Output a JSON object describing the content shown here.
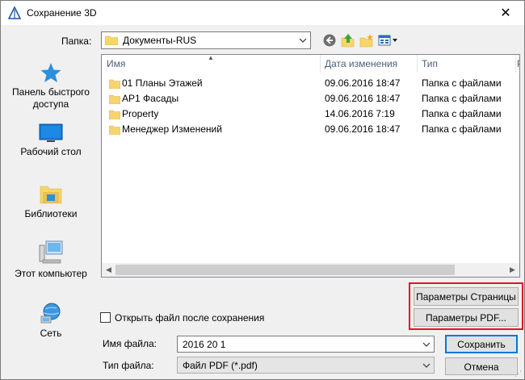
{
  "window": {
    "title": "Сохранение 3D",
    "close_symbol": "✕"
  },
  "folder": {
    "label": "Папка:",
    "value": "Документы-RUS"
  },
  "toolbar": {
    "icons": [
      "back-icon",
      "up-folder-icon",
      "new-folder-icon",
      "view-menu-icon"
    ]
  },
  "places": [
    {
      "label": "Панель быстрого доступа",
      "icon": "star-icon"
    },
    {
      "label": "Рабочий стол",
      "icon": "desktop-icon"
    },
    {
      "label": "Библиотеки",
      "icon": "libraries-icon"
    },
    {
      "label": "Этот компьютер",
      "icon": "computer-icon"
    },
    {
      "label": "Сеть",
      "icon": "network-icon"
    }
  ],
  "filelist": {
    "columns": [
      "Имя",
      "Дата изменения",
      "Тип",
      "Р"
    ],
    "rows": [
      {
        "name": "01 Планы Этажей",
        "date": "09.06.2016 18:47",
        "type": "Папка с файлами"
      },
      {
        "name": "АР1 Фасады",
        "date": "09.06.2016 18:47",
        "type": "Папка с файлами"
      },
      {
        "name": "Property",
        "date": "14.06.2016 7:19",
        "type": "Папка с файлами"
      },
      {
        "name": "Менеджер Изменений",
        "date": "09.06.2016 18:47",
        "type": "Папка с файлами"
      }
    ]
  },
  "buttons": {
    "page_params": "Параметры Страницы",
    "pdf_params": "Параметры PDF...",
    "save": "Сохранить",
    "cancel": "Отмена"
  },
  "open_after_save": {
    "label": "Открыть файл после сохранения",
    "checked": false
  },
  "filename": {
    "label": "Имя файла:",
    "value": "2016 20 1"
  },
  "filetype": {
    "label": "Тип файла:",
    "value": "Файл PDF (*.pdf)"
  },
  "colors": {
    "highlight": "#e81123",
    "folder": "#f6d56e",
    "accent": "#0078d7"
  }
}
